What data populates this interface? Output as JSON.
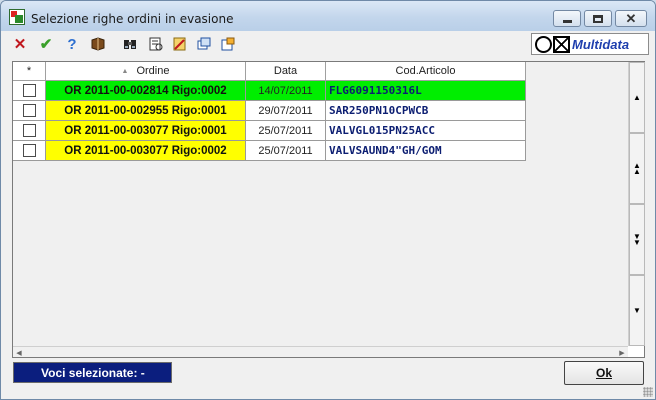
{
  "window": {
    "title": "Selezione righe ordini in evasione",
    "minimize_label": "",
    "maximize_label": "",
    "close_label": "✕"
  },
  "toolbar": {
    "icons": [
      "delete-icon",
      "confirm-check-icon",
      "help-icon",
      "book-icon",
      "binoculars-icon",
      "print-preview-icon",
      "edit-doc-icon",
      "copy-window-icon",
      "export-icon"
    ],
    "brand": "Multidata",
    "colors": {
      "delete": "#c0171e",
      "confirm": "#3aa02a",
      "help": "#2d6fd0",
      "brand": "#1f3fae"
    }
  },
  "grid": {
    "columns": [
      "*",
      "Ordine",
      "Data",
      "Cod.Articolo"
    ],
    "sort_indicator": "▲",
    "rows": [
      {
        "ordine": "OR 2011-00-002814 Rigo:0002",
        "data": "14/07/2011",
        "codice": "FLG6091150316L",
        "highlight": "#00ee00"
      },
      {
        "ordine": "OR 2011-00-002955 Rigo:0001",
        "data": "29/07/2011",
        "codice": "SAR250PN10CPWCB",
        "highlight": "#ffff00"
      },
      {
        "ordine": "OR 2011-00-003077 Rigo:0001",
        "data": "25/07/2011",
        "codice": "VALVGL015PN25ACC",
        "highlight": "#ffff00"
      },
      {
        "ordine": "OR 2011-00-003077 Rigo:0002",
        "data": "25/07/2011",
        "codice": "VALVSAUND4\"GH/GOM",
        "highlight": "#ffff00"
      }
    ],
    "scroll_buttons": [
      "first-icon",
      "page-up-icon",
      "page-down-icon",
      "last-icon"
    ]
  },
  "footer": {
    "status_text": "Voci selezionate: -",
    "ok_label": "Ok",
    "status_color": "#0b1e7e"
  }
}
